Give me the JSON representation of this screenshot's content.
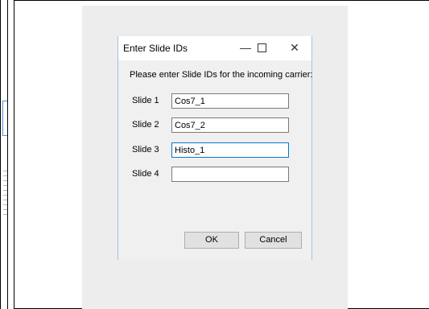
{
  "dialog": {
    "title": "Enter Slide IDs",
    "minimize_glyph": "—",
    "close_glyph": "✕",
    "instruction": "Please enter Slide IDs for the incoming carrier:",
    "slides": [
      {
        "label": "Slide 1",
        "value": "Cos7_1"
      },
      {
        "label": "Slide 2",
        "value": "Cos7_2"
      },
      {
        "label": "Slide 3",
        "value": "Histo_1"
      },
      {
        "label": "Slide 4",
        "value": ""
      }
    ],
    "ok_label": "OK",
    "cancel_label": "Cancel"
  },
  "colors": {
    "focus_border": "#0078d7",
    "dialog_border": "#9ec3e6",
    "dialog_bg": "#f0f0f0"
  }
}
